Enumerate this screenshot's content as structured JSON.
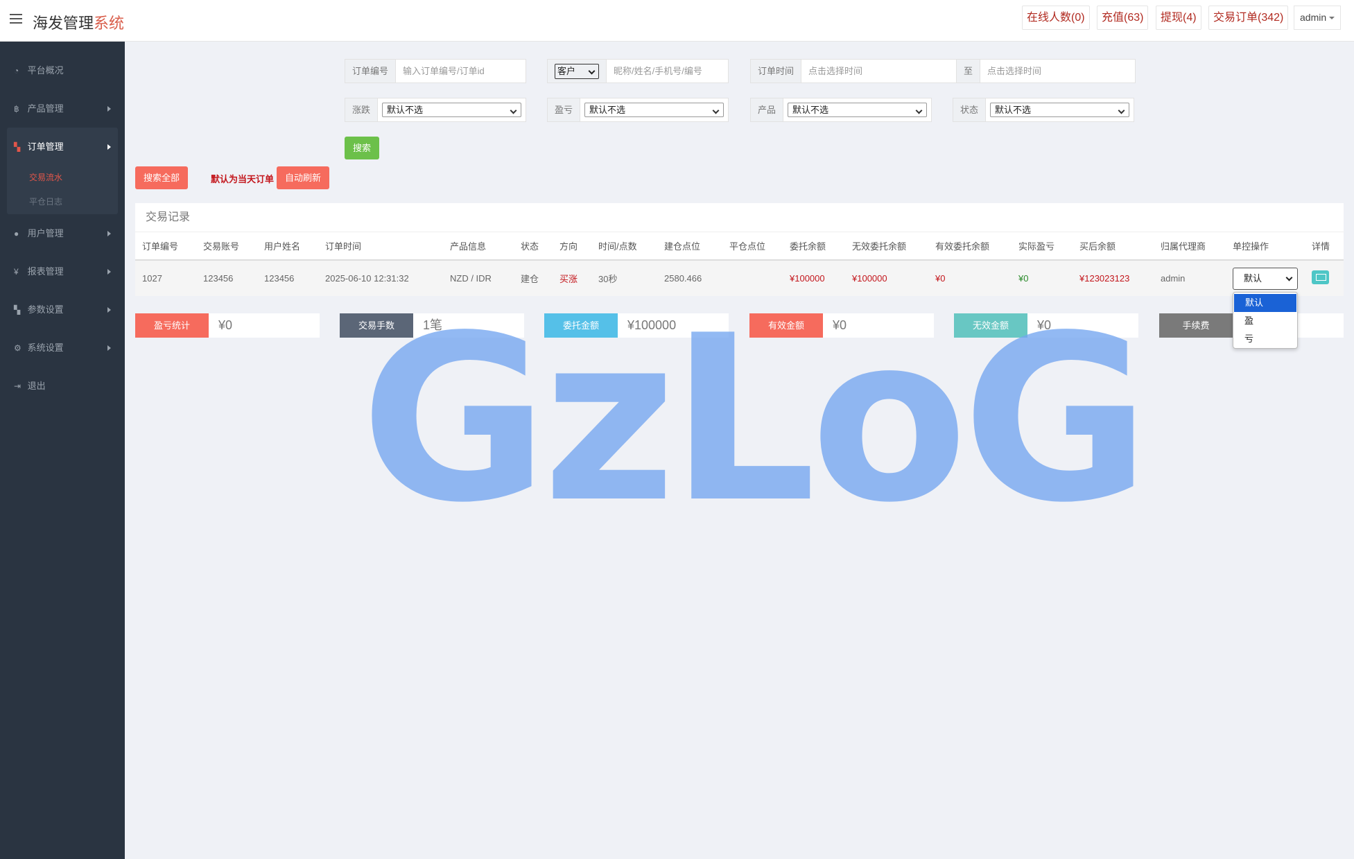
{
  "header": {
    "brand_main": "海发管理",
    "brand_accent": "系统",
    "online": "在线人数(0)",
    "recharge": "充值(63)",
    "withdraw": "提现(4)",
    "orders": "交易订单(342)",
    "user": "admin"
  },
  "sidebar": {
    "items": [
      {
        "label": "平台概况",
        "icon": "dashboard-icon"
      },
      {
        "label": "产品管理",
        "icon": "bitcoin-icon"
      },
      {
        "label": "订单管理",
        "icon": "orders-icon"
      },
      {
        "label": "用户管理",
        "icon": "user-icon"
      },
      {
        "label": "报表管理",
        "icon": "yen-icon"
      },
      {
        "label": "参数设置",
        "icon": "params-icon"
      },
      {
        "label": "系统设置",
        "icon": "gears-icon"
      },
      {
        "label": "退出",
        "icon": "logout-icon"
      }
    ],
    "sub_items": [
      "交易流水",
      "平仓日志"
    ]
  },
  "filters": {
    "order_no_label": "订单编号",
    "order_no_placeholder": "输入订单编号/订单id",
    "customer_select": "客户",
    "customer_placeholder": "昵称/姓名/手机号/编号",
    "order_time_label": "订单时间",
    "time_start_placeholder": "点击选择时间",
    "to_label": "至",
    "time_end_placeholder": "点击选择时间",
    "rise_fall_label": "涨跌",
    "rise_fall_value": "默认不选",
    "profit_label": "盈亏",
    "profit_value": "默认不选",
    "product_label": "产品",
    "product_value": "默认不选",
    "status_label": "状态",
    "status_value": "默认不选",
    "search_button": "搜索"
  },
  "actions": {
    "search_all": "搜索全部",
    "default_note": "默认为当天订单",
    "auto_refresh": "自动刷新"
  },
  "table": {
    "title": "交易记录",
    "headers": [
      "订单编号",
      "交易账号",
      "用户姓名",
      "订单时间",
      "产品信息",
      "状态",
      "方向",
      "时间/点数",
      "建仓点位",
      "平仓点位",
      "委托余额",
      "无效委托余额",
      "有效委托余额",
      "实际盈亏",
      "买后余额",
      "归属代理商",
      "单控操作",
      "详情"
    ],
    "row": {
      "order_no": "1027",
      "account": "123456",
      "name": "123456",
      "time": "2025-06-10 12:31:32",
      "product": "NZD / IDR",
      "status": "建仓",
      "direction": "买涨",
      "duration": "30秒",
      "open_price": "2580.466",
      "close_price": "",
      "entrust": "¥100000",
      "invalid_entrust": "¥100000",
      "valid_entrust": "¥0",
      "pnl": "¥0",
      "balance_after": "¥123023123",
      "agent": "admin",
      "control_value": "默认"
    }
  },
  "control_options": [
    "默认",
    "盈",
    "亏"
  ],
  "stats": [
    {
      "label": "盈亏统计",
      "value": "¥0",
      "color": "#f66b5d"
    },
    {
      "label": "交易手数",
      "value": "1笔",
      "color": "#5b6677"
    },
    {
      "label": "委托金额",
      "value": "¥100000",
      "color": "#55c0e8"
    },
    {
      "label": "有效金额",
      "value": "¥0",
      "color": "#f66b5d"
    },
    {
      "label": "无效金额",
      "value": "¥0",
      "color": "#68c7c3"
    },
    {
      "label": "手续费",
      "value": "",
      "color": "#7a7a7a"
    }
  ],
  "watermark": "GzLoG"
}
